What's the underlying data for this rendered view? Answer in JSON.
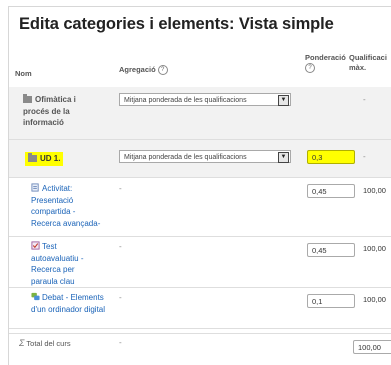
{
  "title": "Edita categories i elements: Vista simple",
  "columns": {
    "name": "Nom",
    "aggregation": "Agregació",
    "weight_line1": "Ponderació",
    "max_line1": "Qualificaci",
    "max_line2": "màx."
  },
  "rows": [
    {
      "name": "Ofimàtica i procés de la informació",
      "aggregation": "Mitjana ponderada de les qualificacions",
      "weight": "",
      "max": "-"
    },
    {
      "name": "UD 1.",
      "aggregation": "Mitjana ponderada de les qualificacions",
      "weight": "0,3",
      "max": "-"
    },
    {
      "name": "Activitat: Presentació compartida -Recerca avançada-",
      "aggregation": "-",
      "weight": "0,45",
      "max": "100,00"
    },
    {
      "name": "Test autoavaluatiu - Recerca per paraula clau",
      "aggregation": "-",
      "weight": "0,45",
      "max": "100,00"
    },
    {
      "name": "Debat - Elements d'un ordinador digital",
      "aggregation": "-",
      "weight": "0,1",
      "max": "100,00"
    },
    {
      "name": "Total del curs",
      "aggregation": "-",
      "weight": "",
      "max": "100,00"
    }
  ],
  "icons": {
    "category": "folder-icon",
    "activity": "assignment-icon",
    "quiz": "quiz-icon",
    "forum": "forum-icon",
    "total": "sigma-icon",
    "help": "help-icon",
    "dropdown": "chevron-down-icon"
  },
  "colors": {
    "highlight": "#ffff00",
    "link": "#1a63b8"
  }
}
